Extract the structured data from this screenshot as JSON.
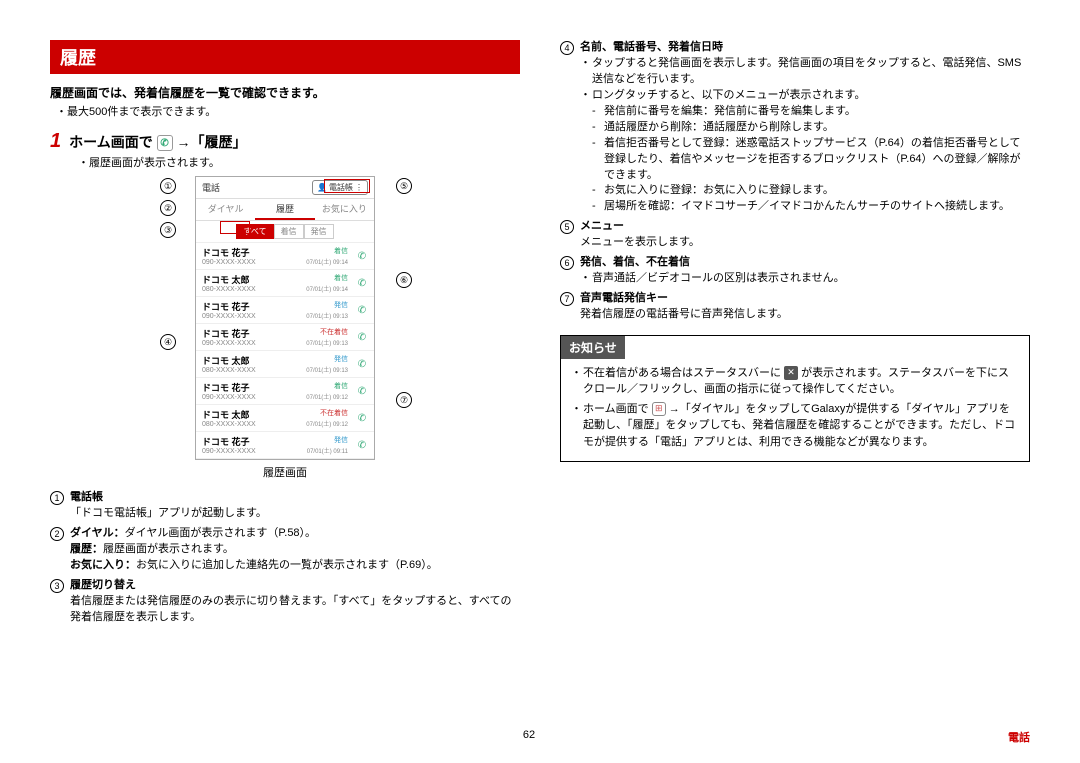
{
  "page": {
    "number": "62",
    "section": "電話"
  },
  "title": "履歴",
  "intro": {
    "line1": "履歴画面では、発着信履歴を一覧で確認できます。",
    "line2": "最大500件まで表示できます。"
  },
  "step": {
    "num": "1",
    "prefix": "ホーム画面で",
    "suffix": "→「履歴」",
    "sub": "履歴画面が表示されます。"
  },
  "phone": {
    "header_left": "電話",
    "header_btn": "電話帳",
    "tabs": [
      "ダイヤル",
      "履歴",
      "お気に入り"
    ],
    "filters": [
      "すべて",
      "着信",
      "発信"
    ],
    "caption": "履歴画面",
    "rows": [
      {
        "name": "ドコモ 花子",
        "num": "090-XXXX-XXXX",
        "tag": "着信",
        "tagclass": "tag-incoming",
        "time": "07/01(土) 09:14"
      },
      {
        "name": "ドコモ 太郎",
        "num": "080-XXXX-XXXX",
        "tag": "着信",
        "tagclass": "tag-incoming",
        "time": "07/01(土) 09:14"
      },
      {
        "name": "ドコモ 花子",
        "num": "090-XXXX-XXXX",
        "tag": "発信",
        "tagclass": "tag-outgoing",
        "time": "07/01(土) 09:13"
      },
      {
        "name": "ドコモ 花子",
        "num": "090-XXXX-XXXX",
        "tag": "不在着信",
        "tagclass": "tag-missed",
        "time": "07/01(土) 09:13"
      },
      {
        "name": "ドコモ 太郎",
        "num": "080-XXXX-XXXX",
        "tag": "発信",
        "tagclass": "tag-outgoing",
        "time": "07/01(土) 09:13"
      },
      {
        "name": "ドコモ 花子",
        "num": "090-XXXX-XXXX",
        "tag": "着信",
        "tagclass": "tag-incoming",
        "time": "07/01(土) 09:12"
      },
      {
        "name": "ドコモ 太郎",
        "num": "080-XXXX-XXXX",
        "tag": "不在着信",
        "tagclass": "tag-missed",
        "time": "07/01(土) 09:12"
      },
      {
        "name": "ドコモ 花子",
        "num": "090-XXXX-XXXX",
        "tag": "発信",
        "tagclass": "tag-outgoing",
        "time": "07/01(土) 09:11"
      }
    ]
  },
  "desc_left": [
    {
      "n": "①",
      "title": "電話帳",
      "body": "「ドコモ電話帳」アプリが起動します。"
    },
    {
      "n": "②",
      "title": "",
      "body": "<span class='b'>ダイヤル：</span>ダイヤル画面が表示されます（P.58）。<br><span class='b'>履歴：</span>履歴画面が表示されます。<br><span class='b'>お気に入り：</span>お気に入りに追加した連絡先の一覧が表示されます（P.69）。"
    },
    {
      "n": "③",
      "title": "履歴切り替え",
      "body": "着信履歴または発信履歴のみの表示に切り替えます。「すべて」をタップすると、すべての発着信履歴を表示します。"
    }
  ],
  "desc_right": [
    {
      "n": "④",
      "title": "名前、電話番号、発着信日時",
      "body": "<ul><li>タップすると発信画面を表示します。発信画面の項目をタップすると、電話発信、SMS送信などを行います。</li><li>ロングタッチすると、以下のメニューが表示されます。<ul><li>発信前に番号を編集：発信前に番号を編集します。</li><li>通話履歴から削除：通話履歴から削除します。</li><li>着信拒否番号として登録：迷惑電話ストップサービス（P.64）の着信拒否番号として登録したり、着信やメッセージを拒否するブロックリスト（P.64）への登録／解除ができます。</li><li>お気に入りに登録：お気に入りに登録します。</li><li>居場所を確認：イマドコサーチ／イマドコかんたんサーチのサイトへ接続します。</li></ul></li></ul>"
    },
    {
      "n": "⑤",
      "title": "メニュー",
      "body": "メニューを表示します。"
    },
    {
      "n": "⑥",
      "title": "発信、着信、不在着信",
      "body": "<ul><li>音声通話／ビデオコールの区別は表示されません。</li></ul>"
    },
    {
      "n": "⑦",
      "title": "音声電話発信キー",
      "body": "発着信履歴の電話番号に音声発信します。"
    }
  ],
  "notice": {
    "head": "お知らせ",
    "items": [
      "不在着信がある場合はステータスバーに <span class='phone-icon-sq' data-name='missed-call-icon' data-interactable='false'>✕</span> が表示されます。ステータスバーを下にスクロール／フリックし、画面の指示に従って操作してください。",
      "ホーム画面で <span class='apps-icon-sq' data-name='apps-icon' data-interactable='false'>⊞</span> →「ダイヤル」をタップしてGalaxyが提供する「ダイヤル」アプリを起動し、「履歴」をタップしても、発着信履歴を確認することができます。ただし、ドコモが提供する「電話」アプリとは、利用できる機能などが異なります。"
    ]
  }
}
